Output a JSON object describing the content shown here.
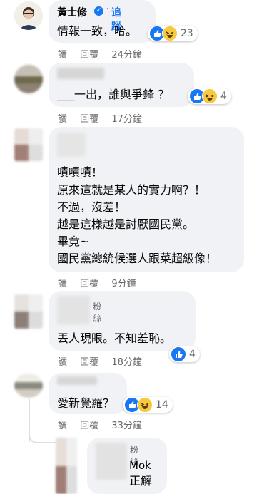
{
  "common": {
    "reply_label": "回覆",
    "read_label": "讀",
    "follow_label": "追蹤"
  },
  "c1": {
    "author": "黃士修",
    "verified": true,
    "follow": "追蹤",
    "text": "情報一致，哈。",
    "read": "讀",
    "reply": "回覆",
    "time": "24分鐘",
    "reactions": [
      "like",
      "haha"
    ],
    "count": "23"
  },
  "c2": {
    "text": "___一出，誰與爭鋒 ？",
    "read": "讀",
    "reply": "回覆",
    "time": "17分鐘",
    "reactions": [
      "like",
      "haha"
    ],
    "count": "4"
  },
  "c3": {
    "lines": [
      "嘖嘖嘖！",
      "原來這就是某人的實力啊？！",
      "不過，沒差！",
      "越是這樣越是討厭國民黨。",
      "畢竟~",
      "國民黨總統候選人跟菜超級像！"
    ],
    "read": "讀",
    "reply": "回覆",
    "time": "9分鐘"
  },
  "c4": {
    "badge": "粉絲",
    "text": "丟人現眼。不知羞恥。",
    "read": "讀",
    "reply": "回覆",
    "time": "18分鐘",
    "reactions": [
      "like"
    ],
    "count": "4"
  },
  "c5": {
    "text": "愛新覺羅？",
    "read": "讀",
    "reply": "回覆",
    "time": "33分鐘",
    "reactions": [
      "like",
      "haha"
    ],
    "count": "14"
  },
  "c6": {
    "badge": "粉絲",
    "name": "Mok",
    "text": "正解"
  }
}
